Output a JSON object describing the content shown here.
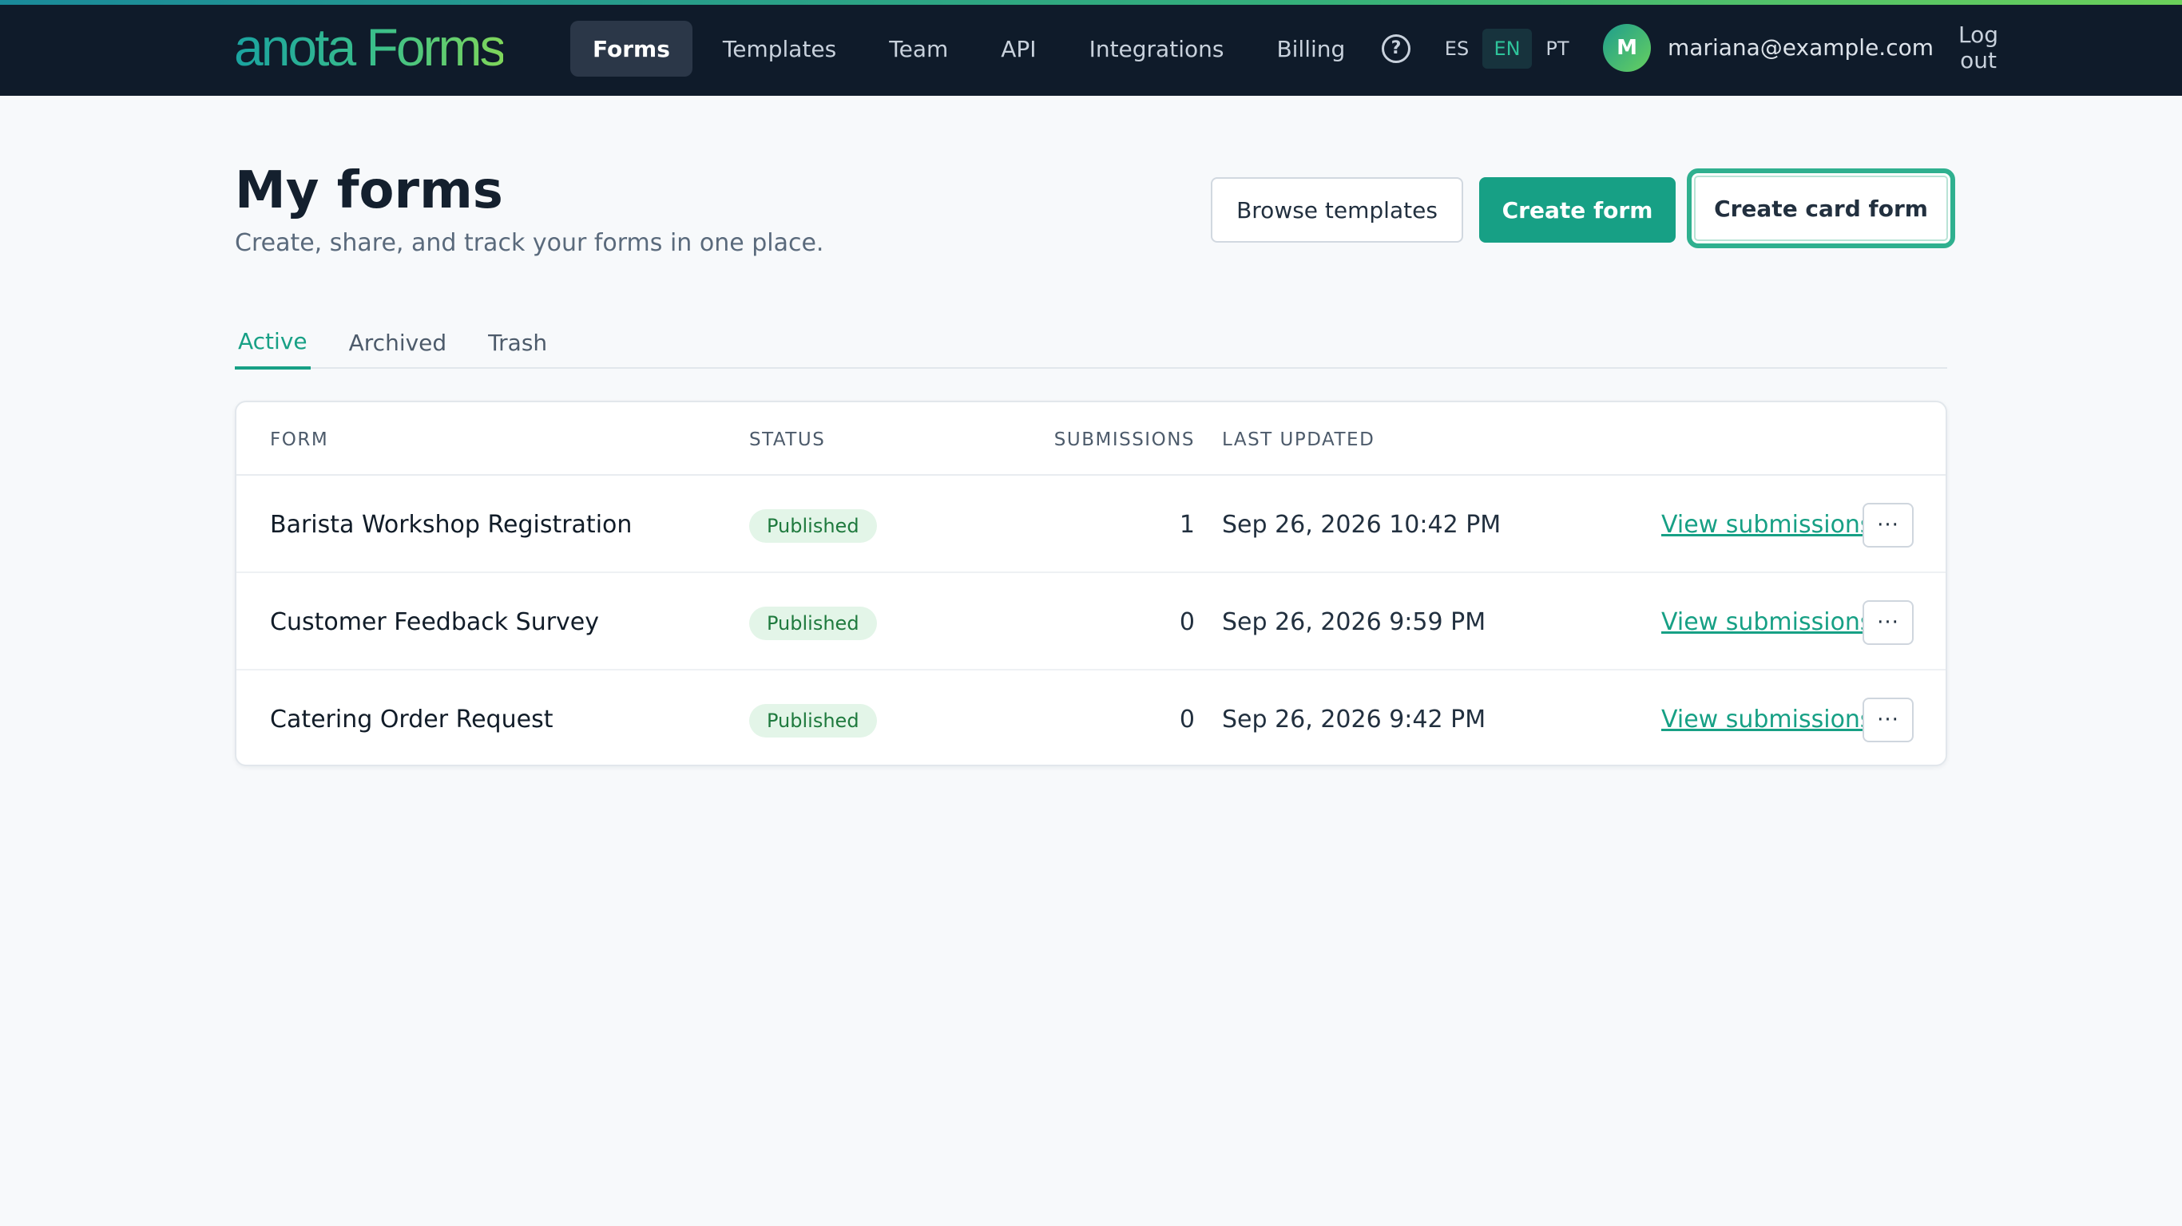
{
  "header": {
    "logo": "anota Forms",
    "nav": [
      {
        "label": "Forms",
        "active": true
      },
      {
        "label": "Templates"
      },
      {
        "label": "Team"
      },
      {
        "label": "API"
      },
      {
        "label": "Integrations"
      },
      {
        "label": "Billing"
      }
    ],
    "help_icon": "?",
    "languages": [
      "ES",
      "EN",
      "PT"
    ],
    "active_language": "EN",
    "avatar_initial": "M",
    "user_email": "mariana@example.com",
    "logout_label": "Log out"
  },
  "page": {
    "title": "My forms",
    "subtitle": "Create, share, and track your forms in one place.",
    "buttons": {
      "browse": "Browse templates",
      "create": "Create form",
      "create_card": "Create card form"
    }
  },
  "tabs": [
    {
      "label": "Active",
      "active": true
    },
    {
      "label": "Archived"
    },
    {
      "label": "Trash"
    }
  ],
  "table": {
    "columns": [
      "FORM",
      "STATUS",
      "SUBMISSIONS",
      "LAST UPDATED"
    ],
    "rows": [
      {
        "name": "Barista Workshop Registration",
        "status": "Published",
        "submissions": "1",
        "updated": "Sep 26, 2026 10:42 PM",
        "action": "View submissions",
        "more": "···"
      },
      {
        "name": "Customer Feedback Survey",
        "status": "Published",
        "submissions": "0",
        "updated": "Sep 26, 2026 9:59 PM",
        "action": "View submissions",
        "more": "···"
      },
      {
        "name": "Catering Order Request",
        "status": "Published",
        "submissions": "0",
        "updated": "Sep 26, 2026 9:42 PM",
        "action": "View submissions",
        "more": "···"
      }
    ]
  },
  "colors": {
    "header_bg": "#0f1b2a",
    "accent": "#17a085",
    "badge_bg": "#e3f5e8",
    "badge_text": "#1f7a3e"
  }
}
